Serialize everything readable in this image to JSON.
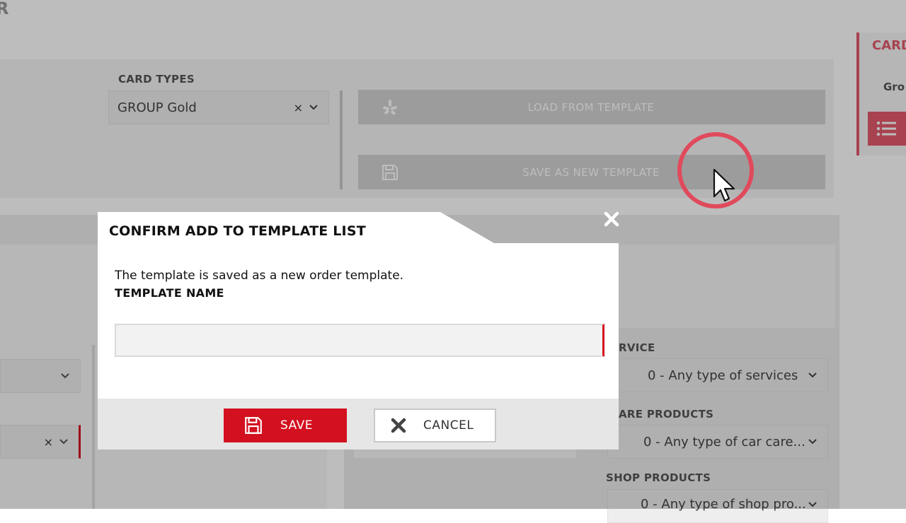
{
  "app": {
    "corner_letter": "R"
  },
  "card_types": {
    "label": "CARD TYPES",
    "selected": "GROUP Gold",
    "clear_symbol": "×"
  },
  "template_buttons": {
    "load_label": "LOAD FROM TEMPLATE",
    "save_new_label": "SAVE AS NEW TEMPLATE"
  },
  "right_card": {
    "title": "CARD",
    "subtitle": "Gro"
  },
  "filters": {
    "left_clear_symbol": "×",
    "service_label": "SERVICE",
    "service_label_visible": "RVICE",
    "service_value": "0 - Any type of services",
    "car_care_label_visible": "ARE PRODUCTS",
    "car_care_value": "0 - Any type of car care...",
    "shop_label": "SHOP PRODUCTS",
    "shop_value": "0 - Any type of shop pro..."
  },
  "modal": {
    "title": "CONFIRM ADD TO TEMPLATE LIST",
    "message": "The template is saved as a new order template.",
    "field_label": "TEMPLATE NAME",
    "field_value": "",
    "field_placeholder": "",
    "save_label": "SAVE",
    "cancel_label": "CANCEL"
  },
  "colors": {
    "accent": "#d3101f",
    "click_ring": "#e04a5c",
    "overlay": "rgba(0,0,0,0.26)"
  },
  "icons": {
    "load_template": "yelp-icon",
    "save_template": "floppy-disk-icon",
    "close": "close-icon",
    "list": "list-icon",
    "dropdown": "chevron-down-icon",
    "cursor": "mouse-pointer-icon"
  }
}
